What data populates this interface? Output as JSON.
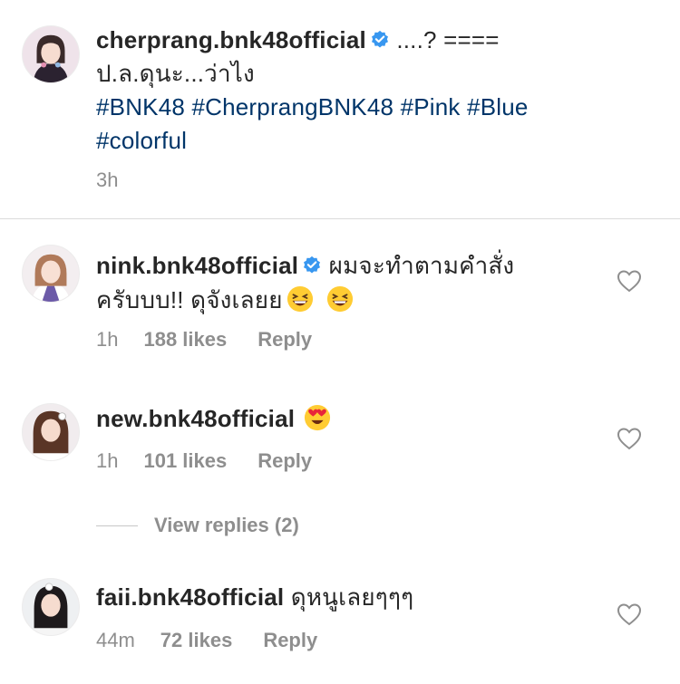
{
  "post": {
    "username": "cherprang.bnk48official",
    "text_line1": " ....? ====",
    "text_line2": "ป.ล.ดุนะ...ว่าไง",
    "hashtags_line1": "#BNK48 #CherprangBNK48 #Pink #Blue",
    "hashtags_line2": "#colorful",
    "time": "3h"
  },
  "comments": [
    {
      "username": "nink.bnk48official",
      "text_line1": " ผมจะทำตามคำสั่ง",
      "text_line2": "ครับบบ!! ดุจังเลยย",
      "emoji": "grinning-squinting-face",
      "time": "1h",
      "likes": "188 likes",
      "reply": "Reply"
    },
    {
      "username": "new.bnk48official",
      "emoji": "heart-eyes-face",
      "time": "1h",
      "likes": "101 likes",
      "reply": "Reply",
      "view_replies": "View replies (2)"
    },
    {
      "username": "faii.bnk48official",
      "text": " ดุหนูเลยๆๆๆ",
      "time": "44m",
      "likes": "72 likes",
      "reply": "Reply"
    }
  ],
  "colors": {
    "hashtag": "#003569",
    "verified": "#3897f0",
    "secondary": "#8e8e8e"
  }
}
